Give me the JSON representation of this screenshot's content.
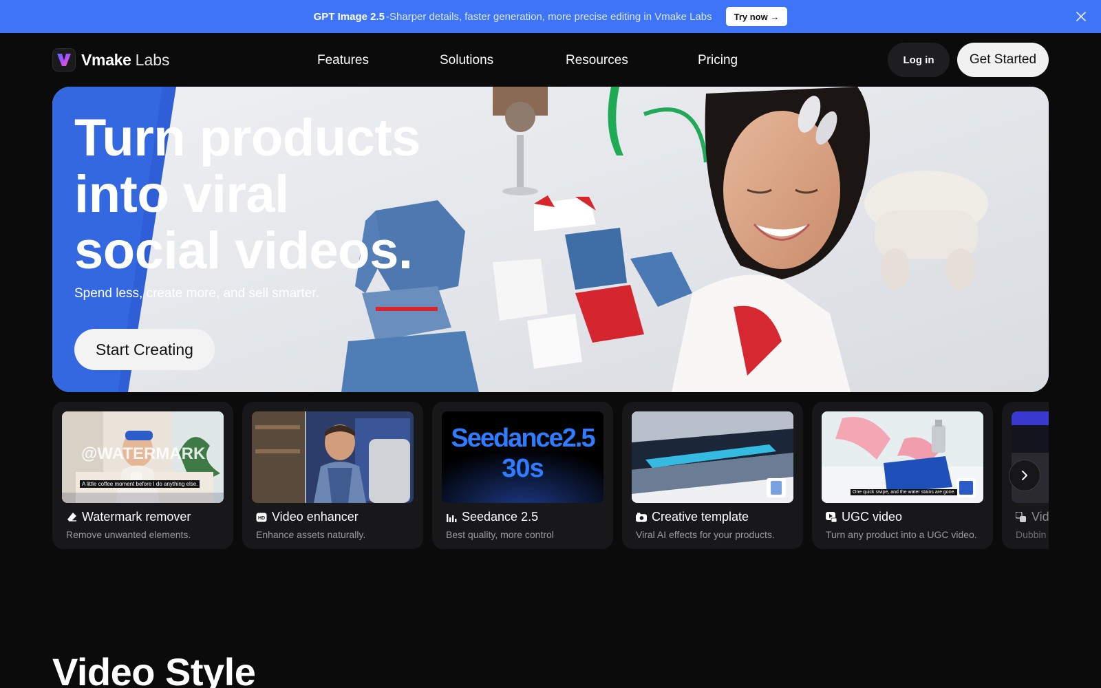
{
  "promo": {
    "title": "GPT Image 2.5",
    "description": "-Sharper details, faster generation, more precise editing in Vmake Labs",
    "button": "Try now →",
    "close_icon": "close-icon"
  },
  "nav": {
    "brand": "Vmake",
    "brand_suffix": "Labs",
    "items": [
      "Features",
      "Solutions",
      "Resources",
      "Pricing"
    ],
    "login": "Log in",
    "get_started": "Get Started"
  },
  "hero": {
    "headline": [
      "Turn products",
      "into viral",
      "social videos."
    ],
    "subtitle": "Spend less, create more, and sell smarter.",
    "cta": "Start Creating"
  },
  "cards": [
    {
      "title": "Watermark remover",
      "desc": "Remove unwanted elements.",
      "icon": "eraser-icon",
      "overlay": "@WATERMARK",
      "caption": "A little coffee moment before I do anything else."
    },
    {
      "title": "Video enhancer",
      "desc": "Enhance assets naturally.",
      "icon": "hd-icon"
    },
    {
      "title": "Seedance 2.5",
      "desc": "Best quality, more control",
      "icon": "bar-chart-icon",
      "overlay_line1": "Seedance2.5",
      "overlay_line2": "30s"
    },
    {
      "title": "Creative template",
      "desc": "Viral AI effects for your products.",
      "icon": "camera-template-icon"
    },
    {
      "title": "UGC video",
      "desc": "Turn any product into a UGC video.",
      "icon": "ugc-icon",
      "caption": "One quick swipe, and the water stains are gone."
    },
    {
      "title": "Vid",
      "desc": "Dubbin",
      "icon": "translate-icon"
    }
  ],
  "next_icon": "chevron-right-icon",
  "section": {
    "title": "Video Style"
  },
  "colors": {
    "banner": "#3e74f7",
    "background": "#0b0b0c",
    "card": "#18181b",
    "hero_accent": "#2f5fd6"
  }
}
